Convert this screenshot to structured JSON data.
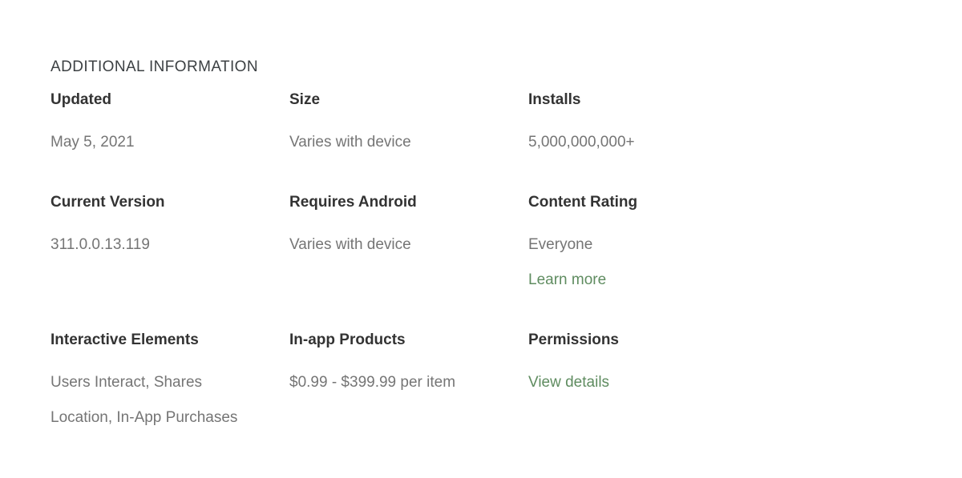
{
  "section": {
    "title": "ADDITIONAL INFORMATION"
  },
  "colors": {
    "background": "#ffffff",
    "label_text": "#333333",
    "value_text": "#757575",
    "title_text": "#3c4043",
    "link_green": "#5f8c60"
  },
  "rows": [
    {
      "cells": [
        {
          "label": "Updated",
          "value": "May 5, 2021",
          "name": "updated"
        },
        {
          "label": "Size",
          "value": "Varies with device",
          "name": "size"
        },
        {
          "label": "Installs",
          "value": "5,000,000,000+",
          "name": "installs"
        }
      ]
    },
    {
      "cells": [
        {
          "label": "Current Version",
          "value": "311.0.0.13.119",
          "name": "current-version"
        },
        {
          "label": "Requires Android",
          "value": "Varies with device",
          "name": "requires-android"
        },
        {
          "label": "Content Rating",
          "value": "Everyone",
          "link": "Learn more",
          "name": "content-rating"
        }
      ]
    },
    {
      "cells": [
        {
          "label": "Interactive Elements",
          "value": "Users Interact, Shares Location, In-App Purchases",
          "name": "interactive-elements"
        },
        {
          "label": "In-app Products",
          "value": "$0.99 - $399.99 per item",
          "name": "in-app-products"
        },
        {
          "label": "Permissions",
          "link": "View details",
          "name": "permissions"
        }
      ]
    }
  ]
}
